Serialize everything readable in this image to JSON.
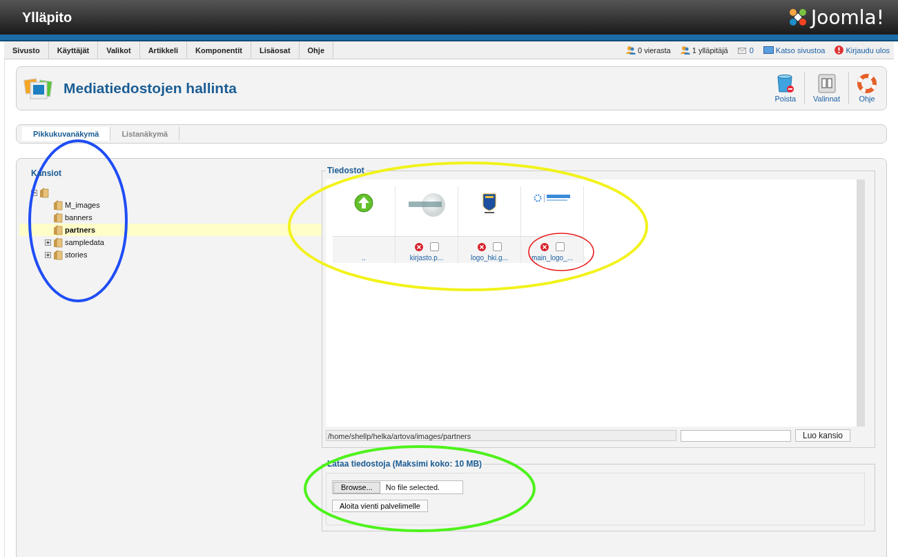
{
  "header": {
    "title": "Ylläpito",
    "logo_text": "Joomla!"
  },
  "menu": [
    "Sivusto",
    "Käyttäjät",
    "Valikot",
    "Artikkeli",
    "Komponentit",
    "Lisäosat",
    "Ohje"
  ],
  "status": [
    {
      "kind": "guests",
      "text": "0 vierasta"
    },
    {
      "kind": "admins",
      "text": "1 ylläpitäjä"
    },
    {
      "kind": "messages",
      "text": "0"
    },
    {
      "kind": "site",
      "text": "Katso sivustoa"
    },
    {
      "kind": "logout",
      "text": "Kirjaudu ulos"
    }
  ],
  "toolbar": {
    "title": "Mediatiedostojen hallinta",
    "buttons": [
      {
        "kind": "delete",
        "label": "Poista"
      },
      {
        "kind": "options",
        "label": "Valinnat"
      },
      {
        "kind": "help",
        "label": "Ohje"
      }
    ]
  },
  "view_tabs": [
    {
      "label": "Pikkukuvanäkymä",
      "selected": true
    },
    {
      "label": "Listanäkymä",
      "selected": false
    }
  ],
  "folders": {
    "title": "Kansiot",
    "tree": [
      {
        "expanded": true,
        "selected": false,
        "children": [
          {
            "label": "M_images",
            "selected": false
          },
          {
            "label": "banners",
            "selected": false
          },
          {
            "label": "partners",
            "selected": true
          },
          {
            "label": "sampledata",
            "expanded": false,
            "selected": false
          },
          {
            "label": "stories",
            "expanded": false,
            "selected": false
          }
        ]
      }
    ]
  },
  "files": {
    "title": "Tiedostot",
    "items": [
      {
        "kind": "up",
        "name": ".."
      },
      {
        "kind": "sphere",
        "name": "kirjasto.p...",
        "checked": false
      },
      {
        "kind": "crest",
        "name": "logo_hki.g...",
        "checked": false
      },
      {
        "kind": "gear",
        "name": "main_logo_...",
        "checked": false
      }
    ],
    "path": "/home/shellp/helka/artova/images/partners",
    "create_button": "Luo kansio"
  },
  "upload": {
    "title": "Lataa tiedostoja (Maksimi koko: 10 MB)",
    "browse_button": "Browse...",
    "file_status": "No file selected.",
    "start_button": "Aloita vienti palvelimelle"
  },
  "annotations": [
    {
      "kind": "ellipse",
      "color": "#1f4df5"
    },
    {
      "kind": "ellipse",
      "color": "#f2f21c"
    },
    {
      "kind": "ellipse",
      "color": "#e81c1c"
    },
    {
      "kind": "ellipse",
      "color": "#4ef21c"
    }
  ]
}
